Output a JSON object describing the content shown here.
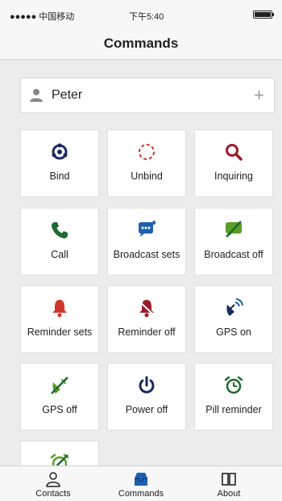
{
  "status_bar": {
    "carrier": "●●●●● 中国移动",
    "time": "下午5:40"
  },
  "nav": {
    "title": "Commands"
  },
  "user": {
    "name": "Peter"
  },
  "commands": [
    {
      "label": "Bind"
    },
    {
      "label": "Unbind"
    },
    {
      "label": "Inquiring"
    },
    {
      "label": "Call"
    },
    {
      "label": "Broadcast sets"
    },
    {
      "label": "Broadcast off"
    },
    {
      "label": "Reminder sets"
    },
    {
      "label": "Reminder off"
    },
    {
      "label": "GPS on"
    },
    {
      "label": "GPS off"
    },
    {
      "label": "Power off"
    },
    {
      "label": "Pill reminder"
    }
  ],
  "tabs": [
    {
      "label": "Contacts"
    },
    {
      "label": "Commands"
    },
    {
      "label": "About"
    }
  ],
  "colors": {
    "navy": "#1a2a5e",
    "red": "#d0352b",
    "maroon": "#9b1c2a",
    "green": "#1d6a2f",
    "blue": "#1f5fb0",
    "lightgreen": "#5a9e2a"
  }
}
